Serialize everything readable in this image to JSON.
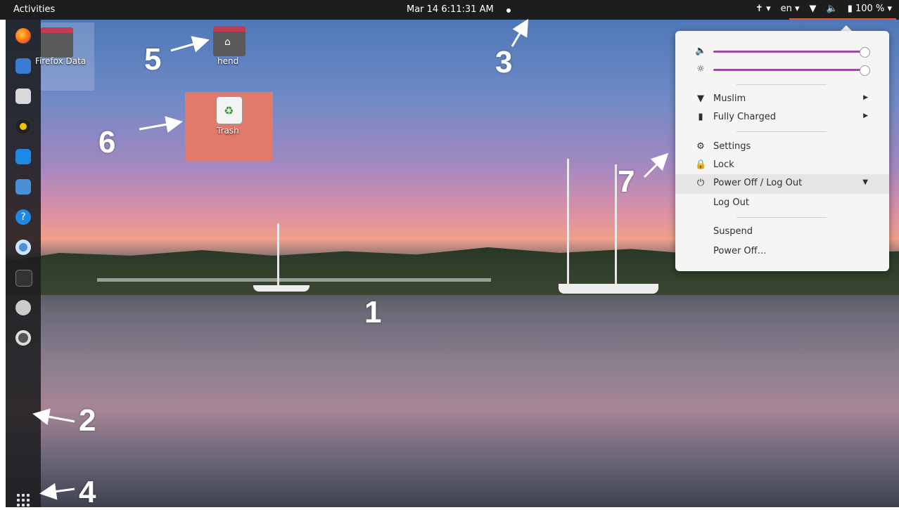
{
  "topbar": {
    "activities": "Activities",
    "clock": "Mar 14  6:11:31 AM",
    "lang": "en",
    "battery": "100 %"
  },
  "desktop": {
    "icons": [
      {
        "label": "Firefox Data"
      },
      {
        "label": "hend"
      },
      {
        "label": "Trash"
      }
    ]
  },
  "annotations": [
    "1",
    "2",
    "3",
    "4",
    "5",
    "6",
    "7"
  ],
  "menu": {
    "network": "Muslim",
    "battery_status": "Fully Charged",
    "settings": "Settings",
    "lock": "Lock",
    "power_header": "Power Off / Log Out",
    "log_out": "Log Out",
    "suspend": "Suspend",
    "power_off": "Power Off…",
    "volume_level": 1.0,
    "brightness_level": 1.0
  },
  "colors": {
    "accent": "#e95420",
    "slider": "#9b4da1",
    "trash_highlight": "#e27a6a"
  }
}
